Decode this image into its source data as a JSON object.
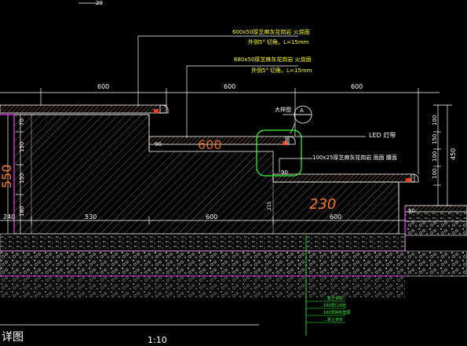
{
  "top_value": "20",
  "callouts": {
    "c1_line1": "600x50厚芝麻灰花岗岩  火烧面",
    "c1_line2": "外侧5°  切角，L=15mm",
    "c2_line1": "680x50厚芝麻灰花岗岩  火烧面",
    "c2_line2": "外侧5°  切角，L=15mm",
    "detail_label": "大样图",
    "detail_id": "A",
    "led": "LED  灯带",
    "c3": "100x25厚芝麻灰花岗岩  面面  腰面"
  },
  "dims": {
    "top_left": "600",
    "top_mid": "600",
    "top_right": "600",
    "bottom_left": "530",
    "bottom_right_step": "600",
    "bottom_right": "600",
    "left_240": "240",
    "step_90_a": "90",
    "step_90_b": "90",
    "step_80": "80",
    "step_215": "215",
    "left_70": "70",
    "left_150": "150",
    "left_150b": "150",
    "left_180": "180",
    "right_100a": "100",
    "right_150a": "150",
    "right_100b": "100",
    "right_100c": "100",
    "right_450": "450"
  },
  "handwritten": {
    "a": "600",
    "b": "550",
    "c": "230"
  },
  "legend_lines": [
    "…素土夯实…",
    "100厚C20砼",
    "100厚碎石垫层",
    "…素土夯实"
  ],
  "footer": {
    "title_fragment": "详图",
    "scale": "1:10"
  },
  "colors": {
    "background": "#000000",
    "line_white": "#ffffff",
    "line_yellow": "#ffff00",
    "line_green": "#33ff33",
    "line_magenta": "#ff33ff",
    "line_orange": "#ff7a18"
  }
}
